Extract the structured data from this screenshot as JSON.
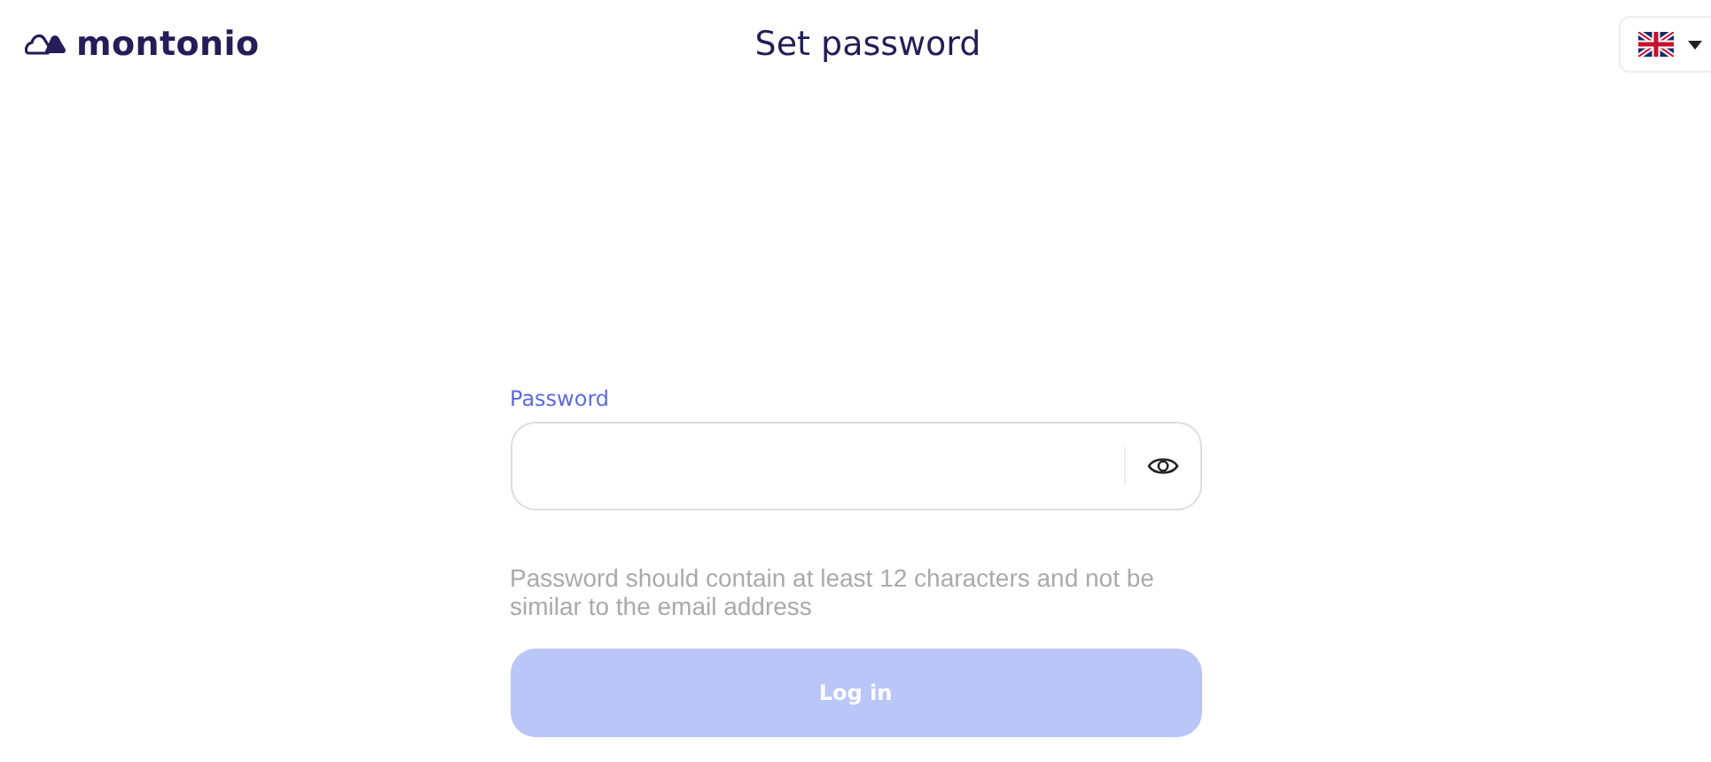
{
  "header": {
    "logo": "montonio",
    "title": "Set password"
  },
  "password": {
    "label": "Password",
    "hint": "Password should contain at least 12 characters and not be similar to the email address"
  },
  "login_button": {
    "label": "Log in",
    "disabled": true
  }
}
